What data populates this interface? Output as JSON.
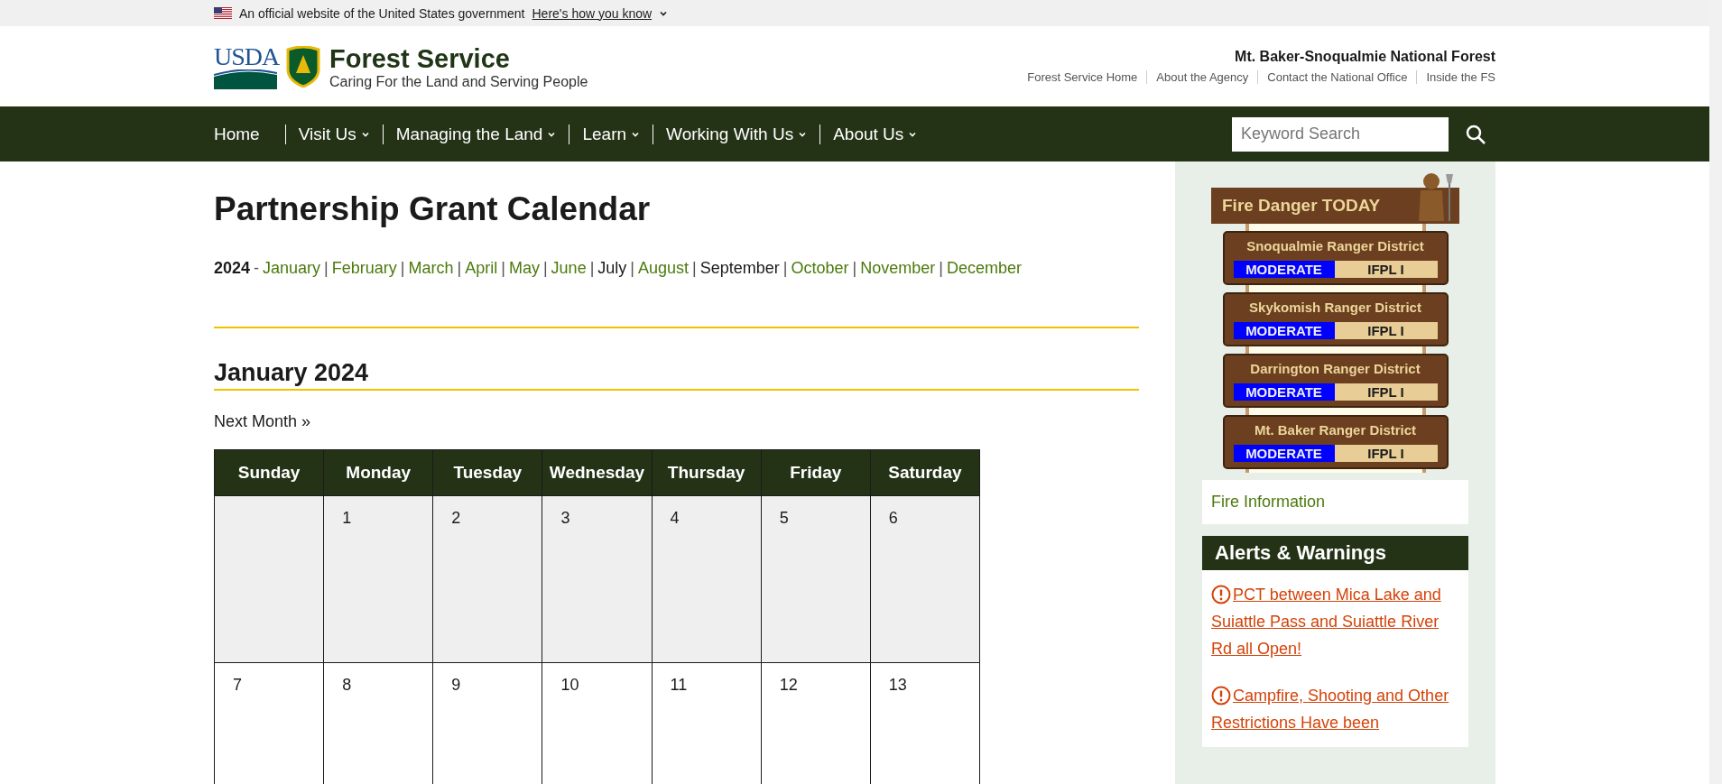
{
  "gov_banner": {
    "text": "An official website of the United States government",
    "link": "Here's how you know"
  },
  "header": {
    "logo_text": "USDA",
    "title": "Forest Service",
    "tagline": "Caring For the Land and Serving People",
    "forest_name": "Mt. Baker-Snoqualmie National Forest",
    "links": [
      "Forest Service Home",
      "About the Agency",
      "Contact the National Office",
      "Inside the FS"
    ]
  },
  "nav": {
    "items": [
      {
        "label": "Home",
        "has_menu": false
      },
      {
        "label": "Visit Us",
        "has_menu": true
      },
      {
        "label": "Managing the Land",
        "has_menu": true
      },
      {
        "label": "Learn",
        "has_menu": true
      },
      {
        "label": "Working With Us",
        "has_menu": true
      },
      {
        "label": "About Us",
        "has_menu": true
      }
    ],
    "search": {
      "placeholder": "Keyword Search"
    }
  },
  "page_title": "Partnership Grant Calendar",
  "year": "2024",
  "year_separator": "-",
  "months": [
    {
      "label": "January",
      "visited": false
    },
    {
      "separator": "|",
      "label": "February",
      "visited": false
    },
    {
      "separator": "|",
      "label": "March",
      "visited": false
    },
    {
      "separator": "|",
      "label": "April",
      "visited": false
    },
    {
      "separator": "|",
      "label": "May",
      "visited": false
    },
    {
      "separator": "|",
      "label": "June",
      "visited": false
    },
    {
      "separator": "|",
      "label": "July",
      "visited": true
    },
    {
      "separator": "|",
      "label": "August",
      "visited": false
    },
    {
      "separator": "|",
      "label": "September",
      "visited": true
    },
    {
      "separator": "|",
      "label": "October",
      "visited": false
    },
    {
      "separator": "|",
      "label": "November",
      "visited": false
    },
    {
      "separator": "|",
      "label": "December",
      "visited": false
    }
  ],
  "month_heading": "January 2024",
  "next_month": "Next Month »",
  "calendar": {
    "columns": [
      "Sunday",
      "Monday",
      "Tuesday",
      "Wednesday",
      "Thursday",
      "Friday",
      "Saturday"
    ],
    "rows": [
      {
        "shaded": true,
        "cells": [
          {},
          {
            "day": "1"
          },
          {
            "day": "2"
          },
          {
            "day": "3"
          },
          {
            "day": "4"
          },
          {
            "day": "5"
          },
          {
            "day": "6"
          }
        ]
      },
      {
        "shaded": false,
        "cells": [
          {
            "day": "7"
          },
          {
            "day": "8"
          },
          {
            "day": "9"
          },
          {
            "day": "10"
          },
          {
            "day": "11"
          },
          {
            "day": "12"
          },
          {
            "day": "13"
          }
        ]
      }
    ]
  },
  "sidebar": {
    "fire_danger": {
      "title": "Fire Danger TODAY",
      "districts": [
        {
          "name": "Snoqualmie Ranger District",
          "rating": "MODERATE",
          "color": "#0000ff",
          "restriction": "IFPL I"
        },
        {
          "name": "Skykomish Ranger District",
          "rating": "MODERATE",
          "color": "#0000ff",
          "restriction": "IFPL I"
        },
        {
          "name": "Darrington Ranger District",
          "rating": "MODERATE",
          "color": "#0000ff",
          "restriction": "IFPL I"
        },
        {
          "name": "Mt. Baker Ranger District",
          "rating": "MODERATE",
          "color": "#0000ff",
          "restriction": "IFPL I"
        }
      ]
    },
    "fire_info_link": "Fire Information",
    "alerts": {
      "title": "Alerts & Warnings",
      "items": [
        "PCT between Mica Lake and Suiattle Pass and Suiattle River Rd all Open!",
        "Campfire, Shooting and Other Restrictions Have been"
      ]
    }
  }
}
